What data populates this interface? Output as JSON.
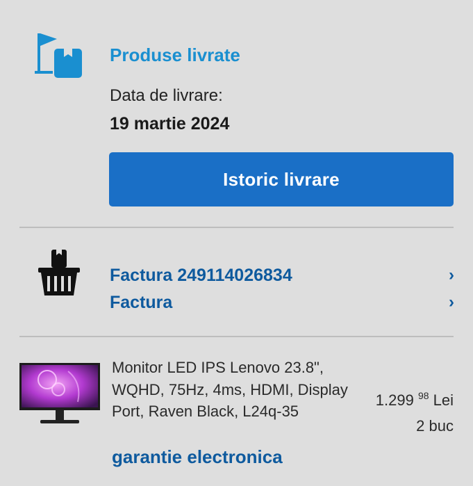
{
  "delivery": {
    "status_title": "Produse livrate",
    "date_label": "Data de livrare:",
    "date_value": "19 martie 2024",
    "history_button": "Istoric livrare",
    "icon": "delivered-flag-box-icon",
    "accent_color": "#1a8fd0",
    "button_color": "#1a6fc6"
  },
  "invoices": {
    "icon": "shopping-basket-icon",
    "links": [
      {
        "label": "Factura 249114026834",
        "chevron": "›"
      },
      {
        "label": "Factura",
        "chevron": "›"
      }
    ],
    "link_color": "#0e5a9e"
  },
  "product": {
    "name": "Monitor LED IPS Lenovo 23.8\", WQHD, 75Hz, 4ms, HDMI, Display Port, Raven Black, L24q-35",
    "price_int": "1.299",
    "price_dec": "98",
    "currency": "Lei",
    "quantity": "2 buc",
    "warranty_link": "garantie electronica",
    "thumbnail": "monitor-product-image"
  }
}
